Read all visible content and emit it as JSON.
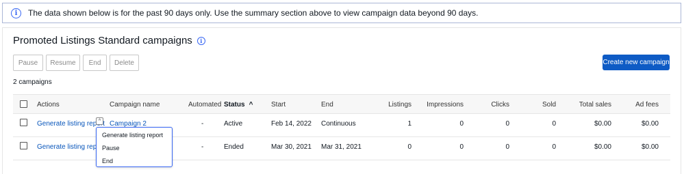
{
  "banner": {
    "message": "The data shown below is for the past 90 days only. Use the summary section above to view campaign data beyond 90 days."
  },
  "section": {
    "title": "Promoted Listings Standard campaigns",
    "count": "2 campaigns"
  },
  "toolbar": {
    "pause": "Pause",
    "resume": "Resume",
    "end": "End",
    "delete": "Delete",
    "create": "Create new campaign"
  },
  "table": {
    "headers": {
      "actions": "Actions",
      "campaign": "Campaign name",
      "automated": "Automated",
      "status": "Status",
      "start": "Start",
      "end": "End",
      "listings": "Listings",
      "impressions": "Impressions",
      "clicks": "Clicks",
      "sold": "Sold",
      "total_sales": "Total sales",
      "ad_fees": "Ad fees"
    },
    "sort_indicator": "^",
    "rows": [
      {
        "action": "Generate listing report",
        "campaign": "Campaign 2",
        "automated": "-",
        "status": "Active",
        "start": "Feb 14, 2022",
        "end": "Continuous",
        "listings": "1",
        "impressions": "0",
        "clicks": "0",
        "sold": "0",
        "total_sales": "$0.00",
        "ad_fees": "$0.00"
      },
      {
        "action": "Generate listing report",
        "campaign": "",
        "automated": "-",
        "status": "Ended",
        "start": "Mar 30, 2021",
        "end": "Mar 31, 2021",
        "listings": "0",
        "impressions": "0",
        "clicks": "0",
        "sold": "0",
        "total_sales": "$0.00",
        "ad_fees": "$0.00"
      }
    ]
  },
  "dropdown_menu": {
    "items": [
      "Generate listing report",
      "Pause",
      "End"
    ]
  },
  "colors": {
    "primary_button": "#0e5bc5",
    "link": "#0654ba",
    "info_icon": "#3665f3",
    "menu_border": "#3665f3"
  }
}
